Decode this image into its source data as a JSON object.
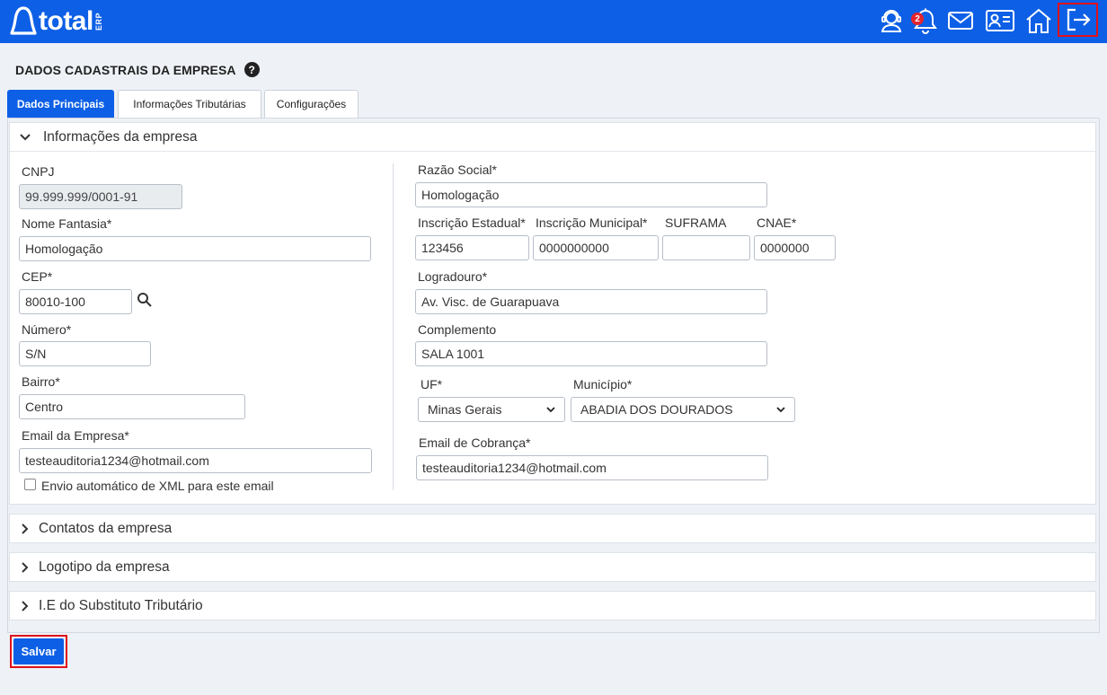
{
  "header": {
    "logo_text": "total",
    "logo_sub": "ERP",
    "notification_count": "2",
    "icons": [
      "support-agent-icon",
      "bell-icon",
      "mail-icon",
      "id-card-icon",
      "home-icon",
      "logout-icon"
    ]
  },
  "page": {
    "title": "DADOS CADASTRAIS DA EMPRESA",
    "help": "?"
  },
  "tabs": [
    {
      "label": "Dados Principais",
      "active": true
    },
    {
      "label": "Informações Tributárias",
      "active": false
    },
    {
      "label": "Configurações",
      "active": false
    }
  ],
  "sections": {
    "company_info": "Informações da empresa",
    "contacts": "Contatos da empresa",
    "logo": "Logotipo da empresa",
    "ie_st": "I.E do Substituto Tributário"
  },
  "form": {
    "cnpj": {
      "label": "CNPJ",
      "value": "99.999.999/0001-91"
    },
    "nome_fantasia": {
      "label": "Nome Fantasia*",
      "value": "Homologação"
    },
    "cep": {
      "label": "CEP*",
      "value": "80010-100"
    },
    "numero": {
      "label": "Número*",
      "value": "S/N"
    },
    "bairro": {
      "label": "Bairro*",
      "value": "Centro"
    },
    "email_empresa": {
      "label": "Email da Empresa*",
      "value": "testeauditoria1234@hotmail.com"
    },
    "envio_xml": {
      "label": "Envio automático de XML para este email",
      "checked": false
    },
    "razao_social": {
      "label": "Razão Social*",
      "value": "Homologação"
    },
    "inscricao_estadual": {
      "label": "Inscrição Estadual*",
      "value": "123456"
    },
    "inscricao_municipal": {
      "label": "Inscrição Municipal*",
      "value": "0000000000"
    },
    "suframa": {
      "label": "SUFRAMA",
      "value": ""
    },
    "cnae": {
      "label": "CNAE*",
      "value": "0000000"
    },
    "logradouro": {
      "label": "Logradouro*",
      "value": "Av. Visc. de Guarapuava"
    },
    "complemento": {
      "label": "Complemento",
      "value": "SALA 1001"
    },
    "uf": {
      "label": "UF*",
      "value": "Minas Gerais"
    },
    "municipio": {
      "label": "Município*",
      "value": "ABADIA DOS DOURADOS"
    },
    "email_cobranca": {
      "label": "Email de Cobrança*",
      "value": "testeauditoria1234@hotmail.com"
    }
  },
  "actions": {
    "save_label": "Salvar"
  },
  "colors": {
    "primary": "#0d5fe6",
    "highlight": "#e0111a",
    "badge": "#e5242c"
  }
}
